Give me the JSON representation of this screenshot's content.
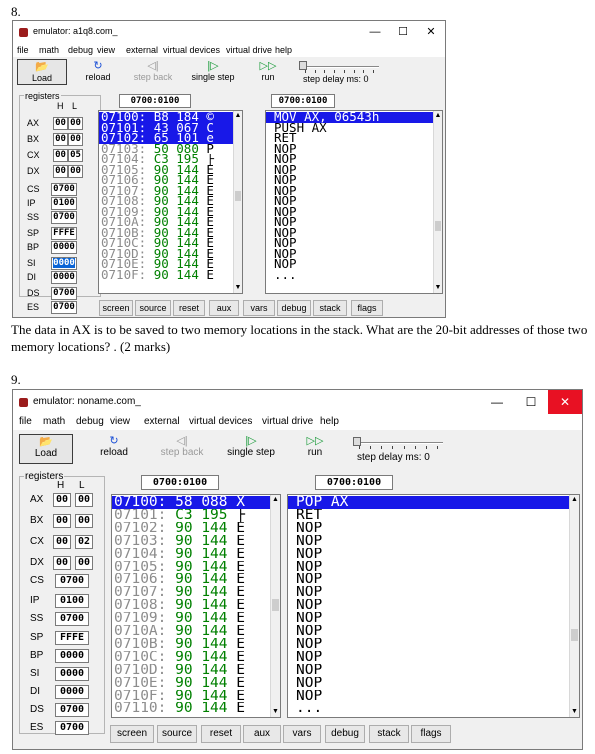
{
  "q8": {
    "number": "8.",
    "title": "emulator: a1q8.com_",
    "window_buttons": [
      "—",
      "☐",
      "✕"
    ],
    "menu": [
      "file",
      "math",
      "debug",
      "view",
      "external",
      "virtual devices",
      "virtual drive",
      "help"
    ],
    "toolbar": [
      {
        "label": "Load",
        "icon": "folder-icon",
        "glyph": "📂",
        "enabled": true
      },
      {
        "label": "reload",
        "icon": "reload-icon",
        "glyph": "↻",
        "enabled": true
      },
      {
        "label": "step back",
        "icon": "step-back-icon",
        "glyph": "◁|",
        "enabled": false
      },
      {
        "label": "single step",
        "icon": "single-step-icon",
        "glyph": "|▷",
        "enabled": true
      },
      {
        "label": "run",
        "icon": "run-icon",
        "glyph": "▷▷",
        "enabled": true
      }
    ],
    "step_delay_label": "step delay ms: 0",
    "registers_legend": "registers",
    "hl_header": [
      "H",
      "L"
    ],
    "registers_8bit": [
      {
        "name": "AX",
        "h": "00",
        "l": "00"
      },
      {
        "name": "BX",
        "h": "00",
        "l": "00"
      },
      {
        "name": "CX",
        "h": "00",
        "l": "05"
      },
      {
        "name": "DX",
        "h": "00",
        "l": "00"
      }
    ],
    "registers_16bit": [
      {
        "name": "CS",
        "value": "0700"
      },
      {
        "name": "IP",
        "value": "0100"
      },
      {
        "name": "SS",
        "value": "0700"
      },
      {
        "name": "SP",
        "value": "FFFE"
      },
      {
        "name": "BP",
        "value": "0000"
      },
      {
        "name": "SI",
        "value": "0000",
        "selected": true
      },
      {
        "name": "DI",
        "value": "0000"
      },
      {
        "name": "DS",
        "value": "0700"
      },
      {
        "name": "ES",
        "value": "0700"
      }
    ],
    "memory_address": "0700:0100",
    "disasm_address": "0700:0100",
    "memory": [
      {
        "addr": "07100:",
        "hex": "B8",
        "dec": "184",
        "ch": "©",
        "sel": true
      },
      {
        "addr": "07101:",
        "hex": "43",
        "dec": "067",
        "ch": "C",
        "sel": true
      },
      {
        "addr": "07102:",
        "hex": "65",
        "dec": "101",
        "ch": "e",
        "sel": true
      },
      {
        "addr": "07103:",
        "hex": "50",
        "dec": "080",
        "ch": "P",
        "sel": false
      },
      {
        "addr": "07104:",
        "hex": "C3",
        "dec": "195",
        "ch": "├",
        "sel": false
      },
      {
        "addr": "07105:",
        "hex": "90",
        "dec": "144",
        "ch": "É",
        "sel": false
      },
      {
        "addr": "07106:",
        "hex": "90",
        "dec": "144",
        "ch": "É",
        "sel": false
      },
      {
        "addr": "07107:",
        "hex": "90",
        "dec": "144",
        "ch": "É",
        "sel": false
      },
      {
        "addr": "07108:",
        "hex": "90",
        "dec": "144",
        "ch": "É",
        "sel": false
      },
      {
        "addr": "07109:",
        "hex": "90",
        "dec": "144",
        "ch": "É",
        "sel": false
      },
      {
        "addr": "0710A:",
        "hex": "90",
        "dec": "144",
        "ch": "É",
        "sel": false
      },
      {
        "addr": "0710B:",
        "hex": "90",
        "dec": "144",
        "ch": "É",
        "sel": false
      },
      {
        "addr": "0710C:",
        "hex": "90",
        "dec": "144",
        "ch": "É",
        "sel": false
      },
      {
        "addr": "0710D:",
        "hex": "90",
        "dec": "144",
        "ch": "É",
        "sel": false
      },
      {
        "addr": "0710E:",
        "hex": "90",
        "dec": "144",
        "ch": "É",
        "sel": false
      },
      {
        "addr": "0710F:",
        "hex": "90",
        "dec": "144",
        "ch": "É",
        "sel": false
      }
    ],
    "disasm": [
      {
        "text": "MOV AX, 06543h",
        "sel": true
      },
      {
        "text": "PUSH AX",
        "sel": false
      },
      {
        "text": "RET",
        "sel": false
      },
      {
        "text": "NOP",
        "sel": false
      },
      {
        "text": "NOP",
        "sel": false
      },
      {
        "text": "NOP",
        "sel": false
      },
      {
        "text": "NOP",
        "sel": false
      },
      {
        "text": "NOP",
        "sel": false
      },
      {
        "text": "NOP",
        "sel": false
      },
      {
        "text": "NOP",
        "sel": false
      },
      {
        "text": "NOP",
        "sel": false
      },
      {
        "text": "NOP",
        "sel": false
      },
      {
        "text": "NOP",
        "sel": false
      },
      {
        "text": "NOP",
        "sel": false
      },
      {
        "text": "NOP",
        "sel": false
      },
      {
        "text": "...",
        "sel": false
      }
    ],
    "bottom_buttons": [
      "screen",
      "source",
      "reset",
      "aux",
      "vars",
      "debug",
      "stack",
      "flags"
    ],
    "question": "The data in AX is to be saved to two memory locations in the stack. What are the 20-bit addresses of those two memory locations?  . (2 marks)"
  },
  "q9": {
    "number": "9.",
    "title": "emulator: noname.com_",
    "window_buttons": [
      "—",
      "☐",
      "✕"
    ],
    "menu": [
      "file",
      "math",
      "debug",
      "view",
      "external",
      "virtual devices",
      "virtual drive",
      "help"
    ],
    "toolbar": [
      {
        "label": "Load",
        "icon": "folder-icon",
        "glyph": "📂",
        "enabled": true
      },
      {
        "label": "reload",
        "icon": "reload-icon",
        "glyph": "↻",
        "enabled": true
      },
      {
        "label": "step back",
        "icon": "step-back-icon",
        "glyph": "◁|",
        "enabled": false
      },
      {
        "label": "single step",
        "icon": "single-step-icon",
        "glyph": "|▷",
        "enabled": true
      },
      {
        "label": "run",
        "icon": "run-icon",
        "glyph": "▷▷",
        "enabled": true
      }
    ],
    "step_delay_label": "step delay ms: 0",
    "registers_legend": "registers",
    "hl_header": [
      "H",
      "L"
    ],
    "registers_8bit": [
      {
        "name": "AX",
        "h": "00",
        "l": "00"
      },
      {
        "name": "BX",
        "h": "00",
        "l": "00"
      },
      {
        "name": "CX",
        "h": "00",
        "l": "02"
      },
      {
        "name": "DX",
        "h": "00",
        "l": "00"
      }
    ],
    "registers_16bit": [
      {
        "name": "CS",
        "value": "0700"
      },
      {
        "name": "IP",
        "value": "0100"
      },
      {
        "name": "SS",
        "value": "0700"
      },
      {
        "name": "SP",
        "value": "FFFE"
      },
      {
        "name": "BP",
        "value": "0000"
      },
      {
        "name": "SI",
        "value": "0000"
      },
      {
        "name": "DI",
        "value": "0000"
      },
      {
        "name": "DS",
        "value": "0700"
      },
      {
        "name": "ES",
        "value": "0700"
      }
    ],
    "memory_address": "0700:0100",
    "disasm_address": "0700:0100",
    "memory": [
      {
        "addr": "07100:",
        "hex": "58",
        "dec": "088",
        "ch": "X",
        "sel": true
      },
      {
        "addr": "07101:",
        "hex": "C3",
        "dec": "195",
        "ch": "├",
        "sel": false
      },
      {
        "addr": "07102:",
        "hex": "90",
        "dec": "144",
        "ch": "É",
        "sel": false
      },
      {
        "addr": "07103:",
        "hex": "90",
        "dec": "144",
        "ch": "É",
        "sel": false
      },
      {
        "addr": "07104:",
        "hex": "90",
        "dec": "144",
        "ch": "É",
        "sel": false
      },
      {
        "addr": "07105:",
        "hex": "90",
        "dec": "144",
        "ch": "É",
        "sel": false
      },
      {
        "addr": "07106:",
        "hex": "90",
        "dec": "144",
        "ch": "É",
        "sel": false
      },
      {
        "addr": "07107:",
        "hex": "90",
        "dec": "144",
        "ch": "É",
        "sel": false
      },
      {
        "addr": "07108:",
        "hex": "90",
        "dec": "144",
        "ch": "É",
        "sel": false
      },
      {
        "addr": "07109:",
        "hex": "90",
        "dec": "144",
        "ch": "É",
        "sel": false
      },
      {
        "addr": "0710A:",
        "hex": "90",
        "dec": "144",
        "ch": "É",
        "sel": false
      },
      {
        "addr": "0710B:",
        "hex": "90",
        "dec": "144",
        "ch": "É",
        "sel": false
      },
      {
        "addr": "0710C:",
        "hex": "90",
        "dec": "144",
        "ch": "É",
        "sel": false
      },
      {
        "addr": "0710D:",
        "hex": "90",
        "dec": "144",
        "ch": "É",
        "sel": false
      },
      {
        "addr": "0710E:",
        "hex": "90",
        "dec": "144",
        "ch": "É",
        "sel": false
      },
      {
        "addr": "0710F:",
        "hex": "90",
        "dec": "144",
        "ch": "É",
        "sel": false
      },
      {
        "addr": "07110:",
        "hex": "90",
        "dec": "144",
        "ch": "É",
        "sel": false
      }
    ],
    "disasm": [
      {
        "text": "POP AX",
        "sel": true
      },
      {
        "text": "RET",
        "sel": false
      },
      {
        "text": "NOP",
        "sel": false
      },
      {
        "text": "NOP",
        "sel": false
      },
      {
        "text": "NOP",
        "sel": false
      },
      {
        "text": "NOP",
        "sel": false
      },
      {
        "text": "NOP",
        "sel": false
      },
      {
        "text": "NOP",
        "sel": false
      },
      {
        "text": "NOP",
        "sel": false
      },
      {
        "text": "NOP",
        "sel": false
      },
      {
        "text": "NOP",
        "sel": false
      },
      {
        "text": "NOP",
        "sel": false
      },
      {
        "text": "NOP",
        "sel": false
      },
      {
        "text": "NOP",
        "sel": false
      },
      {
        "text": "NOP",
        "sel": false
      },
      {
        "text": "NOP",
        "sel": false
      },
      {
        "text": "..."
      }
    ],
    "bottom_buttons": [
      "screen",
      "source",
      "reset",
      "aux",
      "vars",
      "debug",
      "stack",
      "flags"
    ]
  },
  "colors": {
    "selection": "#1818e8",
    "close_button_red": "#e81123",
    "opcode_green": "#008000",
    "address_gray": "#8c8c8c",
    "app_icon": "#9b1c1c"
  }
}
